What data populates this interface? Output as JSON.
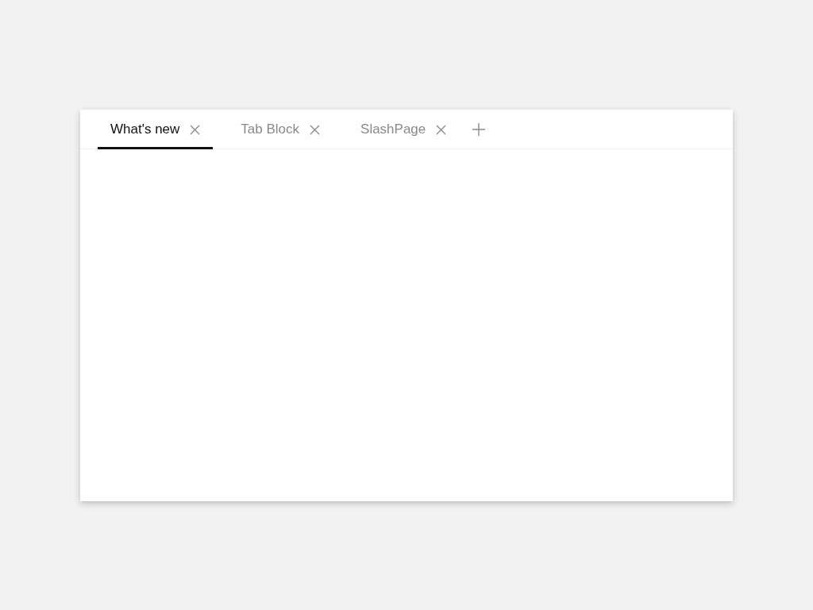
{
  "tabs": [
    {
      "label": "What's new",
      "selected": true
    },
    {
      "label": "Tab Block",
      "selected": false
    },
    {
      "label": "SlashPage",
      "selected": false
    }
  ]
}
